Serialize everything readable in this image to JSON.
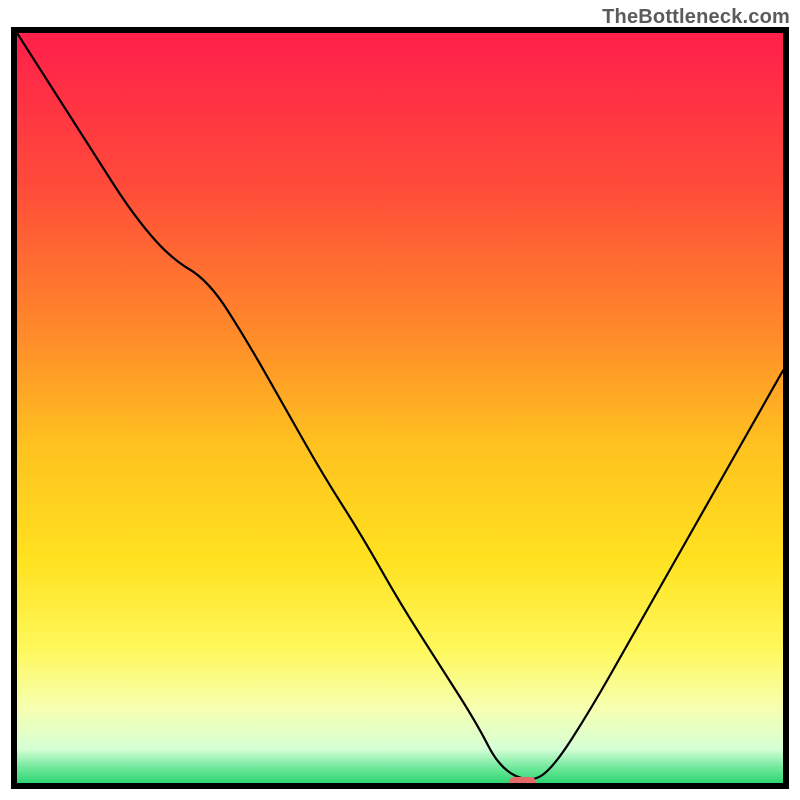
{
  "watermark": "TheBottleneck.com",
  "chart_data": {
    "type": "line",
    "title": "",
    "xlabel": "",
    "ylabel": "",
    "xlim": [
      0,
      100
    ],
    "ylim": [
      0,
      100
    ],
    "grid": false,
    "legend": false,
    "series": [
      {
        "name": "bottleneck-curve",
        "x": [
          0,
          5,
          10,
          15,
          20,
          25,
          30,
          35,
          40,
          45,
          50,
          55,
          60,
          63,
          67,
          70,
          75,
          80,
          85,
          90,
          95,
          100
        ],
        "y": [
          100,
          92,
          84,
          76,
          70,
          67,
          59,
          50,
          41,
          33,
          24,
          16,
          8,
          2,
          0,
          2,
          10,
          19,
          28,
          37,
          46,
          55
        ]
      }
    ],
    "marker": {
      "name": "optimal-point",
      "x": 66,
      "y": 0,
      "width_pct": 3.6,
      "height_pct": 1.6,
      "color": "#e46a6a"
    },
    "gradient_stops": [
      {
        "offset": 0,
        "color": "#ff1f4b"
      },
      {
        "offset": 0.2,
        "color": "#ff4a3a"
      },
      {
        "offset": 0.4,
        "color": "#ff8a2a"
      },
      {
        "offset": 0.55,
        "color": "#ffc21f"
      },
      {
        "offset": 0.7,
        "color": "#ffe11f"
      },
      {
        "offset": 0.82,
        "color": "#fff85a"
      },
      {
        "offset": 0.9,
        "color": "#f6ffb0"
      },
      {
        "offset": 0.955,
        "color": "#d6ffd6"
      },
      {
        "offset": 0.98,
        "color": "#6de89a"
      },
      {
        "offset": 1.0,
        "color": "#2ed573"
      }
    ]
  }
}
